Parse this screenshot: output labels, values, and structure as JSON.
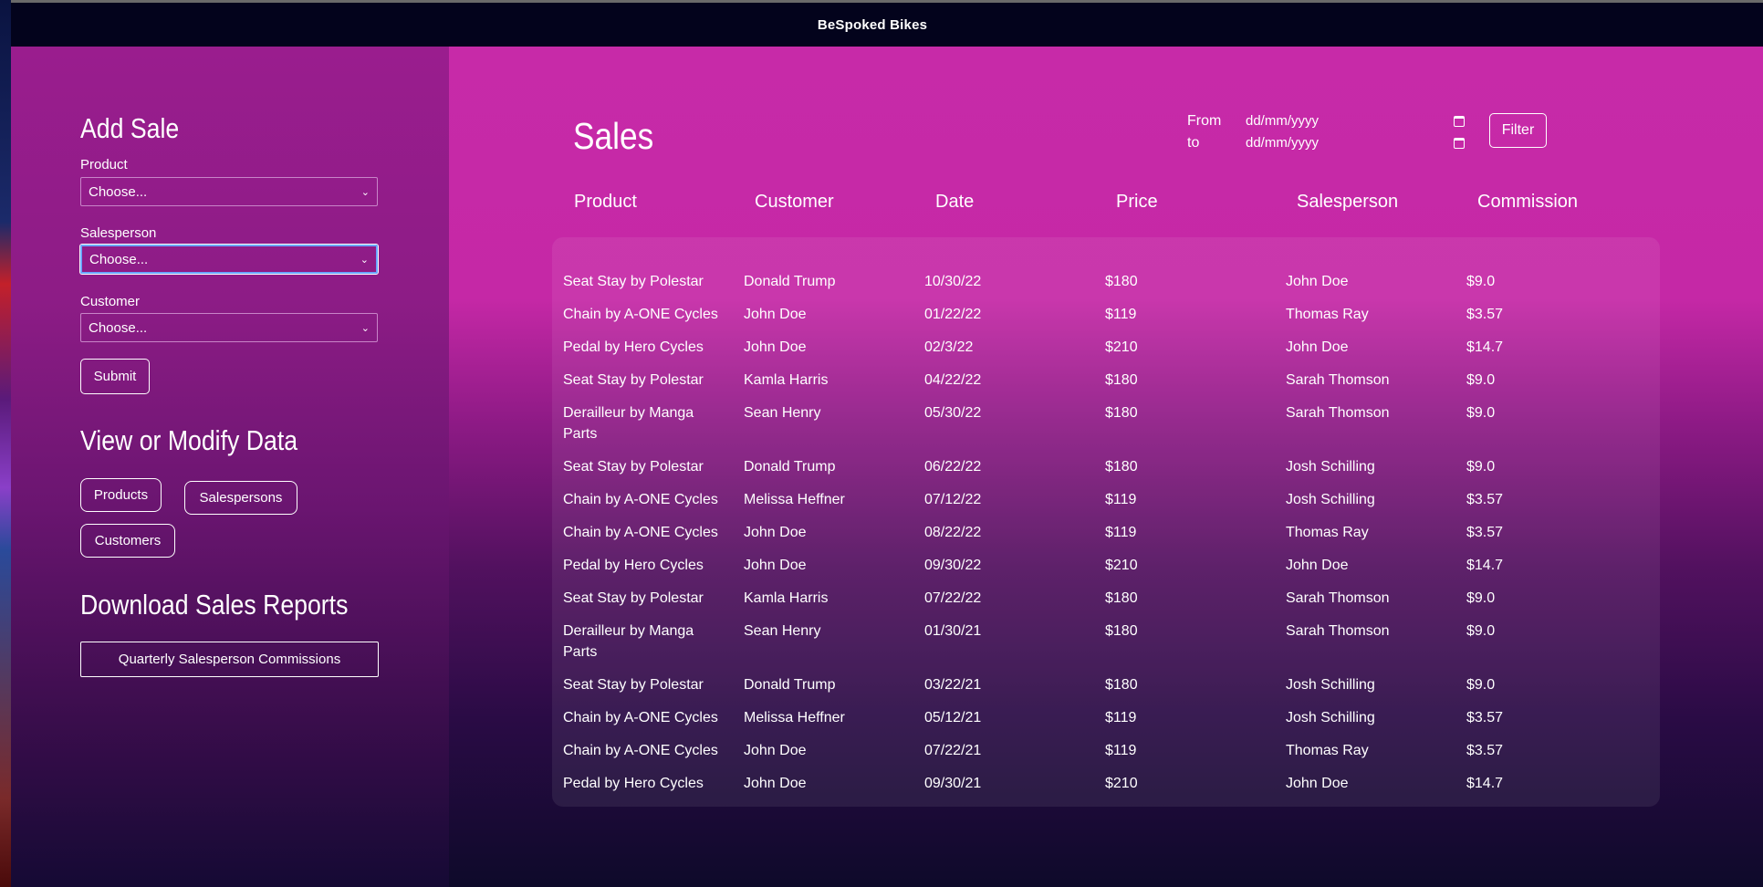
{
  "app": {
    "title": "BeSpoked Bikes"
  },
  "sidebar": {
    "add_sale": {
      "title": "Add Sale",
      "product_label": "Product",
      "product_value": "Choose...",
      "salesperson_label": "Salesperson",
      "salesperson_value": "Choose...",
      "customer_label": "Customer",
      "customer_value": "Choose...",
      "submit_label": "Submit"
    },
    "view_modify": {
      "title": "View or Modify Data",
      "products_label": "Products",
      "salespersons_label": "Salespersons",
      "customers_label": "Customers"
    },
    "reports": {
      "title": "Download Sales Reports",
      "quarterly_label": "Quarterly Salesperson Commissions"
    }
  },
  "sales": {
    "title": "Sales",
    "filter": {
      "from_label": "From",
      "to_label": "to",
      "from_placeholder": "dd/mm/yyyy",
      "to_placeholder": "dd/mm/yyyy",
      "button_label": "Filter"
    },
    "columns": [
      "Product",
      "Customer",
      "Date",
      "Price",
      "Salesperson",
      "Commission"
    ],
    "rows": [
      [
        "Seat Stay by Polestar",
        "Donald Trump",
        "10/30/22",
        "$180",
        "John Doe",
        "$9.0"
      ],
      [
        "Chain by A-ONE Cycles",
        "John Doe",
        "01/22/22",
        "$119",
        "Thomas Ray",
        "$3.57"
      ],
      [
        "Pedal by Hero Cycles",
        "John Doe",
        "02/3/22",
        "$210",
        "John Doe",
        "$14.7"
      ],
      [
        "Seat Stay by Polestar",
        "Kamla Harris",
        "04/22/22",
        "$180",
        "Sarah Thomson",
        "$9.0"
      ],
      [
        "Derailleur by Manga Parts",
        "Sean Henry",
        "05/30/22",
        "$180",
        "Sarah Thomson",
        "$9.0"
      ],
      [
        "Seat Stay by Polestar",
        "Donald Trump",
        "06/22/22",
        "$180",
        "Josh Schilling",
        "$9.0"
      ],
      [
        "Chain by A-ONE Cycles",
        "Melissa Heffner",
        "07/12/22",
        "$119",
        "Josh Schilling",
        "$3.57"
      ],
      [
        "Chain by A-ONE Cycles",
        "John Doe",
        "08/22/22",
        "$119",
        "Thomas Ray",
        "$3.57"
      ],
      [
        "Pedal by Hero Cycles",
        "John Doe",
        "09/30/22",
        "$210",
        "John Doe",
        "$14.7"
      ],
      [
        "Seat Stay by Polestar",
        "Kamla Harris",
        "07/22/22",
        "$180",
        "Sarah Thomson",
        "$9.0"
      ],
      [
        "Derailleur by Manga Parts",
        "Sean Henry",
        "01/30/21",
        "$180",
        "Sarah Thomson",
        "$9.0"
      ],
      [
        "Seat Stay by Polestar",
        "Donald Trump",
        "03/22/21",
        "$180",
        "Josh Schilling",
        "$9.0"
      ],
      [
        "Chain by A-ONE Cycles",
        "Melissa Heffner",
        "05/12/21",
        "$119",
        "Josh Schilling",
        "$3.57"
      ],
      [
        "Chain by A-ONE Cycles",
        "John Doe",
        "07/22/21",
        "$119",
        "Thomas Ray",
        "$3.57"
      ],
      [
        "Pedal by Hero Cycles",
        "John Doe",
        "09/30/21",
        "$210",
        "John Doe",
        "$14.7"
      ]
    ]
  },
  "icons": {
    "select_chevron": "chevron-down-icon",
    "date_picker": "calendar-icon"
  },
  "colors": {
    "topbar": "#03031c",
    "sidebar": "#9a1d8e",
    "main": "#c72aa8",
    "focus": "#6aa6ff"
  }
}
